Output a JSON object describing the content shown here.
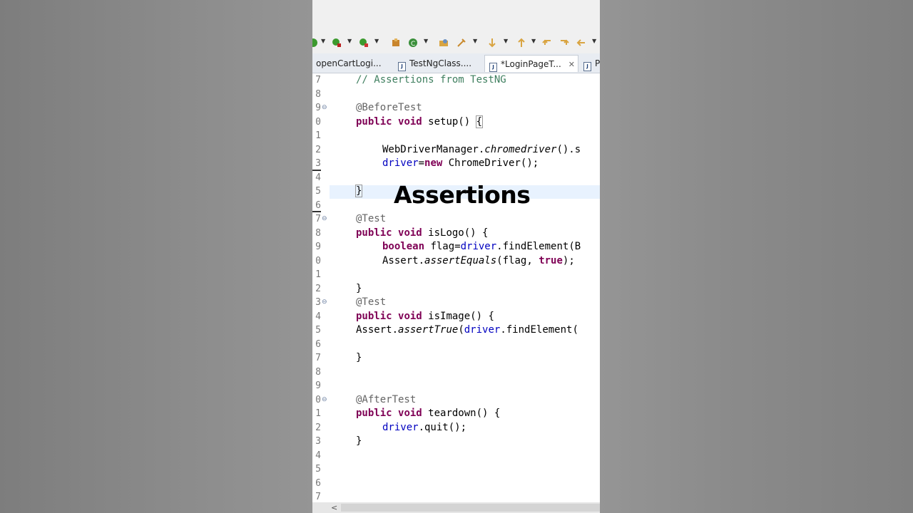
{
  "overlay": {
    "caption": "Assertions"
  },
  "tabs": [
    {
      "label": "openCartLogi...",
      "active": false
    },
    {
      "label": "TestNgClass....",
      "active": false
    },
    {
      "label": "*LoginPageT...",
      "active": true,
      "close": "✕"
    },
    {
      "label": "P",
      "active": false
    }
  ],
  "editor": {
    "lines": [
      {
        "num": "7",
        "text": "// Assertions from TestNG"
      },
      {
        "num": "8",
        "text": ""
      },
      {
        "num": "9",
        "text": "@BeforeTest"
      },
      {
        "num": "0",
        "text": "public void setup() {"
      },
      {
        "num": "1",
        "text": ""
      },
      {
        "num": "2",
        "text": "WebDriverManager.chromedriver().s"
      },
      {
        "num": "3",
        "text": "driver=new ChromeDriver();"
      },
      {
        "num": "4",
        "text": ""
      },
      {
        "num": "5",
        "text": "}"
      },
      {
        "num": "6",
        "text": ""
      },
      {
        "num": "7",
        "text": "@Test"
      },
      {
        "num": "8",
        "text": "public void isLogo() {"
      },
      {
        "num": "9",
        "text": "boolean flag=driver.findElement(B"
      },
      {
        "num": "0",
        "text": "Assert.assertEquals(flag, true);"
      },
      {
        "num": "1",
        "text": ""
      },
      {
        "num": "2",
        "text": "}"
      },
      {
        "num": "3",
        "text": "@Test"
      },
      {
        "num": "4",
        "text": "public void isImage() {"
      },
      {
        "num": "5",
        "text": "Assert.assertTrue(driver.findElement("
      },
      {
        "num": "6",
        "text": ""
      },
      {
        "num": "7",
        "text": "}"
      },
      {
        "num": "8",
        "text": ""
      },
      {
        "num": "9",
        "text": ""
      },
      {
        "num": "0",
        "text": "@AfterTest"
      },
      {
        "num": "1",
        "text": "public void teardown() {"
      },
      {
        "num": "2",
        "text": "driver.quit();"
      },
      {
        "num": "3",
        "text": "}"
      },
      {
        "num": "4",
        "text": ""
      },
      {
        "num": "5",
        "text": ""
      },
      {
        "num": "6",
        "text": ""
      },
      {
        "num": "7",
        "text": ""
      }
    ]
  },
  "colors": {
    "keyword": "#7f0055",
    "comment": "#3f7f5f",
    "annotation": "#646464",
    "field": "#0000c0"
  },
  "scrollbar": {
    "left_arrow": "<"
  }
}
